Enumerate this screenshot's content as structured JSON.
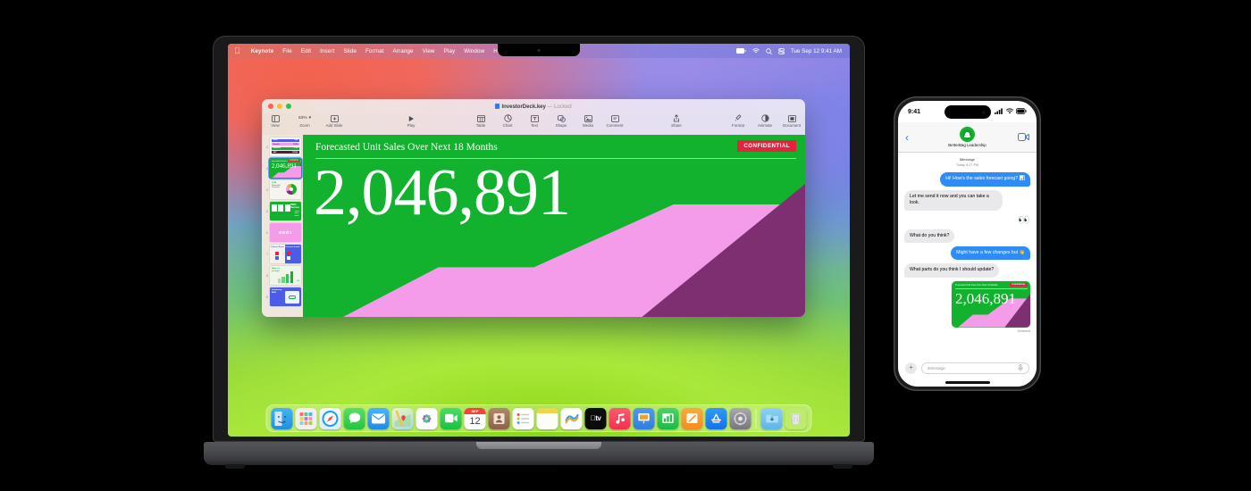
{
  "macbook": {
    "menubar": {
      "apple_icon": "apple-icon",
      "items": [
        "Keynote",
        "File",
        "Edit",
        "Insert",
        "Slide",
        "Format",
        "Arrange",
        "View",
        "Play",
        "Window",
        "Help"
      ],
      "status_icons": [
        "battery-icon",
        "wifi-icon",
        "search-icon",
        "control-center-icon"
      ],
      "clock": "Tue Sep 12 9:41 AM"
    },
    "keynote": {
      "title": "InvestorDeck.key",
      "title_status": "— Locked",
      "toolbar": {
        "left": [
          {
            "label": "View",
            "icon": "sidebar-icon"
          },
          {
            "label": "Zoom",
            "icon": "chevron-down-icon",
            "value": "63%"
          },
          {
            "label": "Add Slide",
            "icon": "add-slide-icon"
          }
        ],
        "play": {
          "label": "Play",
          "icon": "play-icon"
        },
        "insert": [
          {
            "label": "Table",
            "icon": "table-icon"
          },
          {
            "label": "Chart",
            "icon": "chart-icon"
          },
          {
            "label": "Text",
            "icon": "text-icon"
          },
          {
            "label": "Shape",
            "icon": "shape-icon"
          },
          {
            "label": "Media",
            "icon": "media-icon"
          },
          {
            "label": "Comment",
            "icon": "comment-icon"
          }
        ],
        "share": {
          "label": "Share",
          "icon": "share-icon"
        },
        "right": [
          {
            "label": "Format",
            "icon": "format-brush-icon"
          },
          {
            "label": "Animate",
            "icon": "animate-icon"
          },
          {
            "label": "Document",
            "icon": "document-icon"
          }
        ]
      },
      "navigator": {
        "selected_slide": 3,
        "slides": [
          {
            "number": 2,
            "kind": "metrics-table"
          },
          {
            "number": 3,
            "kind": "big-number"
          },
          {
            "number": 4,
            "kind": "donut-chart",
            "text": "FY24 Financial Controls"
          },
          {
            "number": 5,
            "kind": "cards",
            "text": "BB03 Success"
          },
          {
            "number": 6,
            "kind": "title-pink",
            "text": "BB♻2"
          },
          {
            "number": 7,
            "kind": "two-panel",
            "text_left": "Delivery Roster",
            "text_right": "Pressure Growth"
          },
          {
            "number": 8,
            "kind": "bar-chart",
            "text": "What's in the bag?"
          },
          {
            "number": 9,
            "kind": "intro",
            "text": "Introducing BB03"
          }
        ]
      },
      "slide": {
        "title": "Forecasted Unit Sales Over Next 18 Months",
        "badge": "CONFIDENTIAL",
        "big_number": "2,046,891",
        "colors": {
          "background": "#12b12e",
          "pink": "#f49bea",
          "purple": "#7d2f72",
          "badge": "#e4243f"
        }
      }
    },
    "dock": {
      "apps": [
        {
          "name": "finder-icon",
          "running": true
        },
        {
          "name": "launchpad-icon",
          "running": false
        },
        {
          "name": "safari-icon",
          "running": false
        },
        {
          "name": "messages-icon",
          "running": false
        },
        {
          "name": "mail-icon",
          "running": false
        },
        {
          "name": "maps-icon",
          "running": false
        },
        {
          "name": "photos-icon",
          "running": false
        },
        {
          "name": "facetime-icon",
          "running": false
        },
        {
          "name": "calendar-icon",
          "running": false,
          "month": "SEP",
          "day": "12"
        },
        {
          "name": "contacts-icon",
          "running": false
        },
        {
          "name": "reminders-icon",
          "running": false
        },
        {
          "name": "notes-icon",
          "running": false
        },
        {
          "name": "freeform-icon",
          "running": false
        },
        {
          "name": "appletv-icon",
          "running": false
        },
        {
          "name": "music-icon",
          "running": false
        },
        {
          "name": "keynote-icon",
          "running": true
        },
        {
          "name": "numbers-icon",
          "running": false
        },
        {
          "name": "pages-icon",
          "running": false
        },
        {
          "name": "appstore-icon",
          "running": false
        },
        {
          "name": "settings-icon",
          "running": false
        }
      ],
      "extras": [
        {
          "name": "downloads-folder-icon"
        },
        {
          "name": "trash-icon"
        }
      ]
    }
  },
  "iphone": {
    "status": {
      "time": "9:41",
      "icons": [
        "cellular-icon",
        "wifi-icon",
        "battery-icon"
      ]
    },
    "nav": {
      "back_icon": "chevron-left-icon",
      "contact_name": "BetterBag Leadership",
      "avatar_icon": "group-avatar-icon",
      "facetime_icon": "facetime-video-icon"
    },
    "thread": {
      "service": "iMessage",
      "timestamp": "Today 9:27 PM",
      "messages": [
        {
          "side": "out",
          "text": "Hi! How's the sales forecast going? 📊"
        },
        {
          "side": "in",
          "text": "Let me send it now and you can take a look."
        },
        {
          "side": "reaction",
          "text": "👀"
        },
        {
          "side": "in",
          "text": "What do you think?"
        },
        {
          "side": "out",
          "text": "Might have a few changes but 👋"
        },
        {
          "side": "in",
          "text": "What parts do you think I should update?"
        }
      ],
      "attachment": {
        "title": "Forecasted Unit Sales Over Next 18 Months",
        "badge": "CONFIDENTIAL",
        "big_number": "2,046,891"
      },
      "delivery_status": "Delivered"
    },
    "input": {
      "plus_icon": "plus-icon",
      "placeholder": "iMessage",
      "mic_icon": "microphone-icon"
    }
  }
}
